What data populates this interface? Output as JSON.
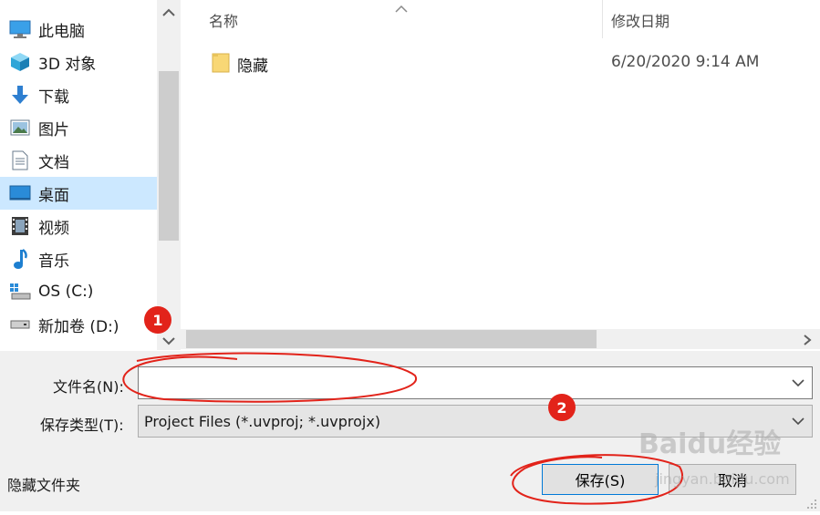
{
  "nav": {
    "items": [
      {
        "label": "此电脑",
        "icon": "computer-icon"
      },
      {
        "label": "3D 对象",
        "icon": "3d-objects-icon"
      },
      {
        "label": "下载",
        "icon": "download-icon"
      },
      {
        "label": "图片",
        "icon": "pictures-icon"
      },
      {
        "label": "文档",
        "icon": "documents-icon"
      },
      {
        "label": "桌面",
        "icon": "desktop-icon",
        "selected": true
      },
      {
        "label": "视频",
        "icon": "videos-icon"
      },
      {
        "label": "音乐",
        "icon": "music-icon"
      },
      {
        "label": "OS (C:)",
        "icon": "drive-c-icon"
      },
      {
        "label": "新加卷 (D:)",
        "icon": "drive-d-icon"
      }
    ]
  },
  "list": {
    "columns": {
      "name": "名称",
      "date": "修改日期"
    },
    "rows": [
      {
        "name": "隐藏",
        "date": "6/20/2020 9:14 AM",
        "icon": "folder-icon"
      }
    ]
  },
  "form": {
    "filename_label": "文件名(N):",
    "filename_value": "",
    "filetype_label": "保存类型(T):",
    "filetype_value": "Project Files (*.uvproj; *.uvprojx)"
  },
  "footer": {
    "hide_folders": "隐藏文件夹",
    "save_label": "保存(S)",
    "cancel_label": "取消"
  },
  "annotations": {
    "badge1": "1",
    "badge2": "2",
    "watermark": "Baidu经验",
    "watermark_sub": "jingyan.baidu.com"
  },
  "colors": {
    "selection": "#cce8ff",
    "panel": "#f0f0f0",
    "annotation_red": "#e2231a",
    "folder": "#f8d775"
  }
}
